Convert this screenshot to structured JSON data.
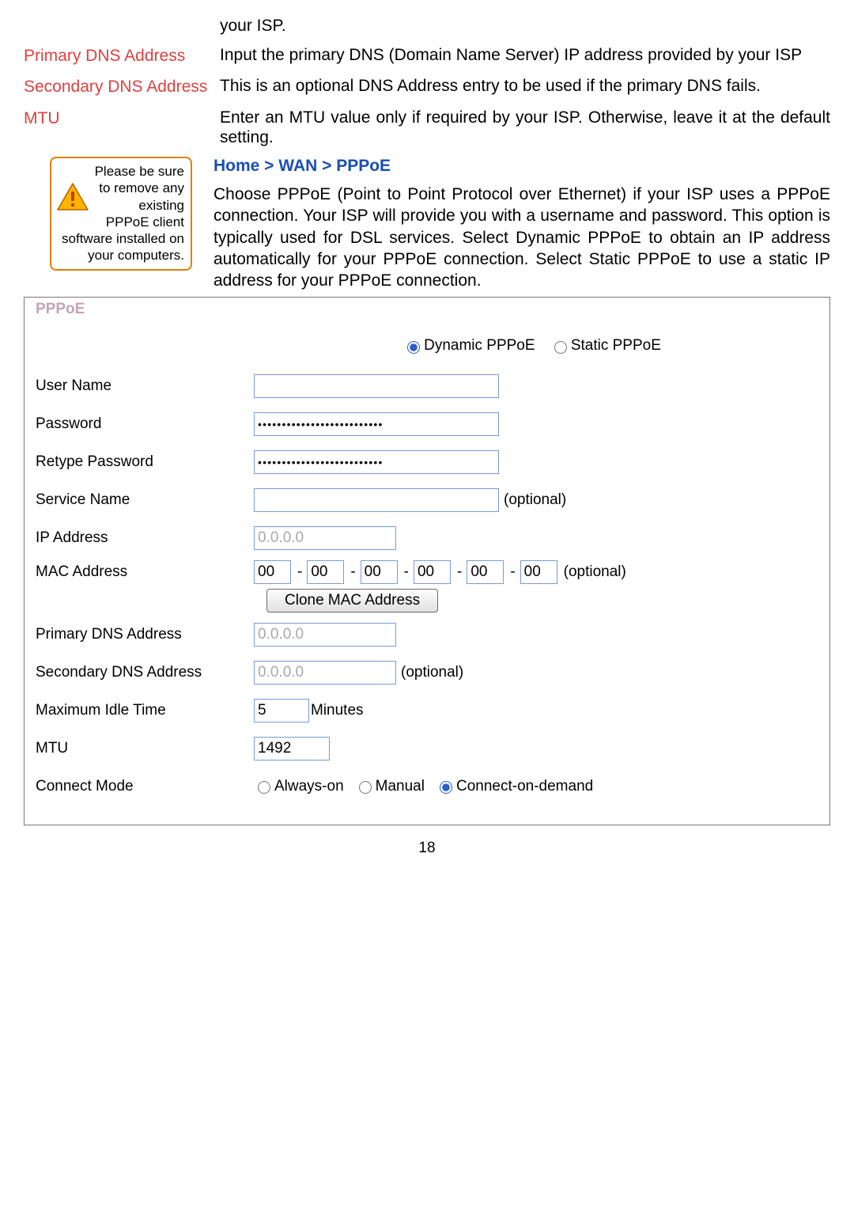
{
  "top": {
    "isp_trail": "your ISP.",
    "primary_dns_label": "Primary DNS Address",
    "primary_dns_desc": "Input the primary DNS (Domain Name Server) IP address provided by your ISP",
    "secondary_dns_label": "Secondary DNS Address",
    "secondary_dns_desc": "This is an optional DNS Address entry to be used if the primary DNS fails.",
    "mtu_label": "MTU",
    "mtu_desc": "Enter an MTU value only if required by your ISP. Otherwise, leave it at the default setting."
  },
  "breadcrumb": "Home > WAN > PPPoE",
  "warning_text": "Please be sure to remove any existing PPPoE client software installed on your computers.",
  "pppoe_intro": "Choose PPPoE (Point to Point Protocol over Ethernet) if your ISP uses a PPPoE connection. Your ISP will provide you with a username and password. This option is typically used for DSL services. Select Dynamic PPPoE to obtain an IP address automatically for your PPPoE connection. Select Static PPPoE to use a static IP address for your PPPoE connection.",
  "panel": {
    "title": "PPPoE",
    "mode": {
      "dynamic_label": "Dynamic PPPoE",
      "static_label": "Static PPPoE",
      "selected": "dynamic"
    },
    "username_label": "User Name",
    "username_value": "",
    "password_label": "Password",
    "password_value": "••••••••••••••••••••••••••",
    "retype_label": "Retype Password",
    "retype_value": "••••••••••••••••••••••••••",
    "service_label": "Service Name",
    "service_value": "",
    "optional_hint": "(optional)",
    "ip_label": "IP Address",
    "ip_value": "0.0.0.0",
    "mac_label": "MAC Address",
    "mac": [
      "00",
      "00",
      "00",
      "00",
      "00",
      "00"
    ],
    "mac_sep": "-",
    "clone_button": "Clone MAC Address",
    "primary_dns_label": "Primary DNS Address",
    "primary_dns_value": "0.0.0.0",
    "secondary_dns_label": "Secondary DNS Address",
    "secondary_dns_value": "0.0.0.0",
    "max_idle_label": "Maximum Idle Time",
    "max_idle_value": "5",
    "max_idle_unit": "Minutes",
    "mtu_label": "MTU",
    "mtu_value": "1492",
    "connect_label": "Connect Mode",
    "connect": {
      "always_label": "Always-on",
      "manual_label": "Manual",
      "demand_label": "Connect-on-demand",
      "selected": "demand"
    }
  },
  "page_number": "18"
}
